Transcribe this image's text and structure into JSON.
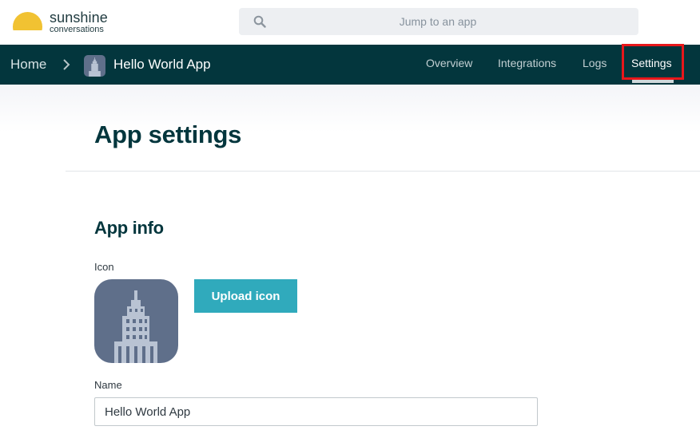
{
  "brand": {
    "name": "sunshine",
    "subtitle": "conversations",
    "sun_color": "#f1c232"
  },
  "search": {
    "placeholder": "Jump to an app",
    "value": ""
  },
  "breadcrumb": {
    "home": "Home",
    "app_name": "Hello World App"
  },
  "nav": {
    "tabs": [
      {
        "label": "Overview",
        "active": false
      },
      {
        "label": "Integrations",
        "active": false
      },
      {
        "label": "Logs",
        "active": false
      },
      {
        "label": "Settings",
        "active": true
      }
    ]
  },
  "page": {
    "title": "App settings",
    "section_title": "App info",
    "icon_label": "Icon",
    "upload_button": "Upload icon",
    "name_label": "Name",
    "name_value": "Hello World App"
  },
  "colors": {
    "navbar": "#03363d",
    "accent": "#30aabc",
    "highlight": "#e8171b",
    "app_icon_bg": "#5f6f8a"
  }
}
